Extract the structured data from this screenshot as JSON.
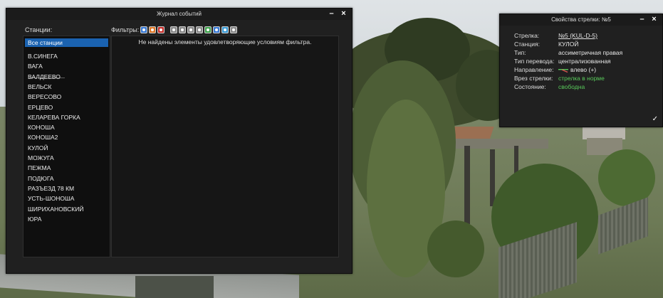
{
  "events_window": {
    "title": "Журнал событий",
    "minimize": "–",
    "close": "×",
    "stations_label": "Станции:",
    "filters_label": "Фильтры:",
    "no_results": "Не найдены элементы удовлетворяющие условиям фильтра.",
    "stations": [
      "Все станции",
      "В.СИНЕГА",
      "ВАГА",
      "ВАЛДЕЕВО",
      "ВЕЛЬСК",
      "ВЕРЕСОВО",
      "ЕРЦЕВО",
      "КЕЛАРЕВА ГОРКА",
      "КОНОША",
      "КОНОША2",
      "КУЛОЙ",
      "МОЖУГА",
      "ПЕЖМА",
      "ПОДЮГА",
      "РАЗЪЕЗД 78 КМ",
      "УСТЬ-ШОНОША",
      "ШИРИХАНОВСКИЙ",
      "ЮРА"
    ],
    "filter_icons": [
      {
        "name": "filter-event-icon-1",
        "color": "#3a7bd5"
      },
      {
        "name": "filter-event-icon-2",
        "color": "#e07a2a"
      },
      {
        "name": "filter-event-icon-3",
        "color": "#c9302c"
      },
      {
        "name": "filter-type-icon-1",
        "color": "#8a8a8a"
      },
      {
        "name": "filter-type-icon-2",
        "color": "#8a8a8a"
      },
      {
        "name": "filter-type-icon-3",
        "color": "#8a8a8a"
      },
      {
        "name": "filter-type-icon-4",
        "color": "#8a8a8a"
      },
      {
        "name": "filter-type-icon-5",
        "color": "#3fa34d"
      },
      {
        "name": "filter-type-icon-6",
        "color": "#3a7bd5"
      },
      {
        "name": "filter-type-icon-7",
        "color": "#3a9bd5"
      },
      {
        "name": "filter-type-icon-8",
        "color": "#8a8a8a"
      }
    ]
  },
  "props_window": {
    "title": "Свойства стрелки: №5",
    "minimize": "–",
    "close": "×",
    "ok": "✓",
    "rows": [
      {
        "label": "Стрелка:",
        "value": "№5 (KUL-D-5)",
        "style": "link"
      },
      {
        "label": "Станция:",
        "value": "КУЛОЙ",
        "style": ""
      },
      {
        "label": "Тип:",
        "value": "ассиметричная правая",
        "style": ""
      },
      {
        "label": "Тип перевода:",
        "value": "централизованная",
        "style": ""
      },
      {
        "label": "Направление:",
        "value": "влево (+)",
        "style": "dir"
      },
      {
        "label": "Врез стрелки:",
        "value": "стрелка в норме",
        "style": "green"
      },
      {
        "label": "Состояние:",
        "value": "свободна",
        "style": "green"
      }
    ]
  },
  "colors": {
    "selection": "#1a62b0",
    "status_ok": "#58c85a"
  }
}
